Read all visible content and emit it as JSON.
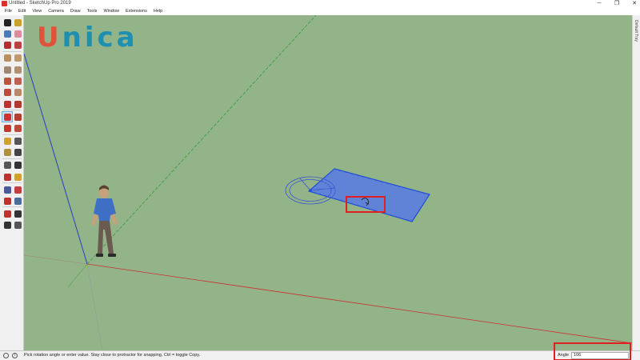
{
  "window": {
    "title": "Untitled - SketchUp Pro 2019",
    "minimize_glyph": "─",
    "maximize_glyph": "❐",
    "close_glyph": "✕"
  },
  "menu": [
    "File",
    "Edit",
    "View",
    "Camera",
    "Draw",
    "Tools",
    "Window",
    "Extensions",
    "Help"
  ],
  "watermark": {
    "part1": "U",
    "part2": "nica"
  },
  "toolbar": {
    "active_tool": "rotate-tool",
    "tools": [
      {
        "name": "select-tool-icon",
        "color": "#222222"
      },
      {
        "name": "component-tool-icon",
        "color": "#c8a030"
      },
      {
        "name": "paint-bucket-tool-icon",
        "color": "#4a7ab8"
      },
      {
        "name": "eraser-tool-icon",
        "color": "#e08aa0"
      },
      {
        "name": "line-tool-icon",
        "color": "#b03030"
      },
      {
        "name": "freehand-tool-icon",
        "color": "#c04040"
      },
      {
        "name": "rectangle-tool-icon",
        "color": "#b89060"
      },
      {
        "name": "rotated-rectangle-tool-icon",
        "color": "#c09870"
      },
      {
        "name": "circle-tool-icon",
        "color": "#a08870"
      },
      {
        "name": "polygon-tool-icon",
        "color": "#b09070"
      },
      {
        "name": "arc-tool-icon",
        "color": "#c05040"
      },
      {
        "name": "arc-center-tool-icon",
        "color": "#c06050"
      },
      {
        "name": "three-point-arc-tool-icon",
        "color": "#c04a40"
      },
      {
        "name": "pie-tool-icon",
        "color": "#b88868"
      },
      {
        "name": "move-tool-icon",
        "color": "#c03030"
      },
      {
        "name": "push-pull-tool-icon",
        "color": "#b03a30"
      },
      {
        "name": "rotate-tool-icon",
        "color": "#d03030"
      },
      {
        "name": "follow-me-tool-icon",
        "color": "#b04030"
      },
      {
        "name": "scale-tool-icon",
        "color": "#c03a2a"
      },
      {
        "name": "offset-tool-icon",
        "color": "#c04a3a"
      },
      {
        "name": "tape-measure-tool-icon",
        "color": "#d0a030"
      },
      {
        "name": "dimension-tool-icon",
        "color": "#555555"
      },
      {
        "name": "protractor-tool-icon",
        "color": "#b09040"
      },
      {
        "name": "text-tool-icon",
        "color": "#444444"
      },
      {
        "name": "axes-tool-icon",
        "color": "#555555"
      },
      {
        "name": "3d-text-tool-icon",
        "color": "#333333"
      },
      {
        "name": "orbit-tool-icon",
        "color": "#c03030"
      },
      {
        "name": "pan-tool-icon",
        "color": "#d0a030"
      },
      {
        "name": "zoom-tool-icon",
        "color": "#4a5a9a"
      },
      {
        "name": "zoom-window-tool-icon",
        "color": "#c04040"
      },
      {
        "name": "zoom-extents-tool-icon",
        "color": "#c03030"
      },
      {
        "name": "previous-view-tool-icon",
        "color": "#4a6aa0"
      },
      {
        "name": "position-camera-tool-icon",
        "color": "#c03030"
      },
      {
        "name": "look-around-tool-icon",
        "color": "#333333"
      },
      {
        "name": "walk-tool-icon",
        "color": "#333333"
      },
      {
        "name": "section-plane-tool-icon",
        "color": "#555555"
      }
    ]
  },
  "tray": {
    "label": "Default Tray"
  },
  "status": {
    "message": "Pick rotation angle or enter value.  Stay close to protractor for snapping, Ctrl = toggle Copy.",
    "vcb_label": "Angle",
    "vcb_value": "106"
  },
  "colors": {
    "ground": "#93b388",
    "selection": "#1f4fd6",
    "axis_red": "#cc3030",
    "axis_green": "#2e9e3e",
    "axis_blue": "#2a3ec0",
    "highlight": "#e02020"
  }
}
